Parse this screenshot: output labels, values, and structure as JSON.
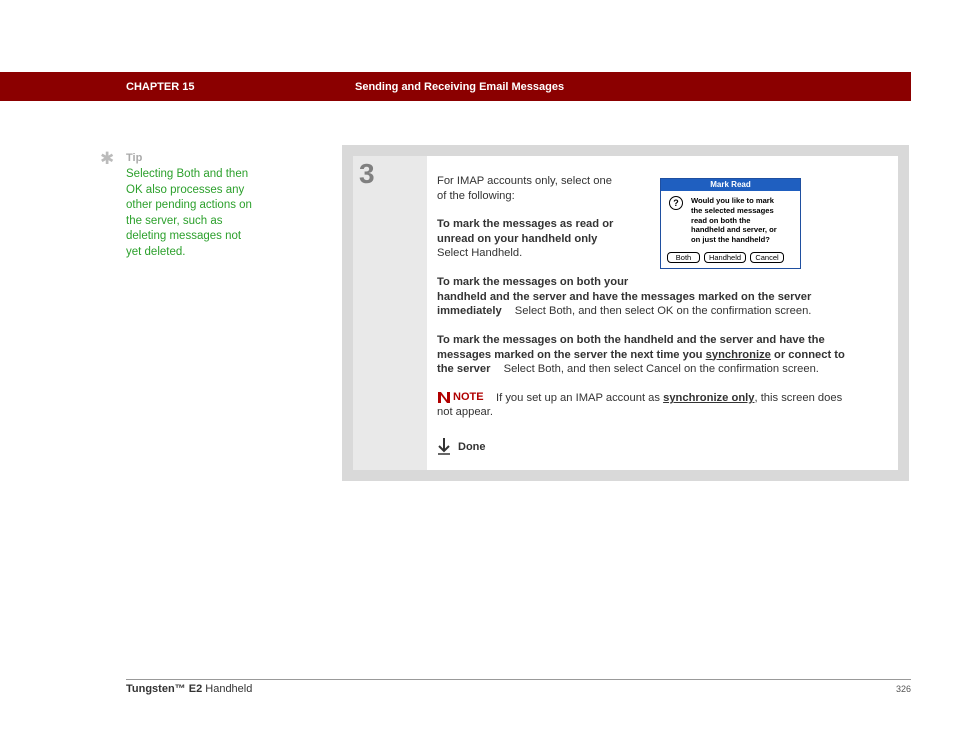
{
  "header": {
    "chapter": "CHAPTER 15",
    "title": "Sending and Receiving Email Messages",
    "bar_color": "#8b0000"
  },
  "tip": {
    "icon": "asterisk-icon",
    "label": "Tip",
    "lines": [
      "Selecting Both and then",
      "OK also processes any",
      "other pending actions on",
      "the server, such as",
      "deleting messages not",
      "yet deleted."
    ],
    "color": "#2ca02c"
  },
  "step": {
    "number": "3",
    "intro_lines": [
      "For IMAP accounts only, select one",
      "of the following:"
    ],
    "option1": {
      "heading_lines": [
        "To mark the messages as read or",
        "unread on your handheld only"
      ],
      "action": "Select Handheld."
    },
    "option2": {
      "heading_line1": "To mark the messages on both your",
      "heading_line2": "handheld and the server and have the messages marked on the server",
      "heading_line3": "immediately",
      "action": "Select Both, and then select OK on the confirmation screen."
    },
    "option3": {
      "heading_line1": "To mark the messages on both the handheld and the server and have the",
      "heading_line2_pre": "messages marked on the server the next time you",
      "link": "synchronize",
      "heading_line2_post": "or connect to",
      "heading_line3": "the server",
      "action": "Select Both, and then select Cancel on the confirmation screen."
    },
    "note": {
      "icon": "note-icon",
      "label": "NOTE",
      "text_pre": "If you set up an IMAP account as",
      "link": "synchronize only",
      "text_post": ", this screen does",
      "text_line2": "not appear."
    },
    "done": {
      "icon": "done-arrow-icon",
      "label": "Done"
    }
  },
  "dialog": {
    "title": "Mark Read",
    "icon": "question-icon",
    "message_lines": [
      "Would you like to mark",
      "the selected messages",
      "read on both the",
      "handheld and server, or",
      "on just the handheld?"
    ],
    "buttons": [
      "Both",
      "Handheld",
      "Cancel"
    ]
  },
  "footer": {
    "product_bold": "Tungsten™ E2",
    "product_rest": " Handheld",
    "page": "326"
  }
}
